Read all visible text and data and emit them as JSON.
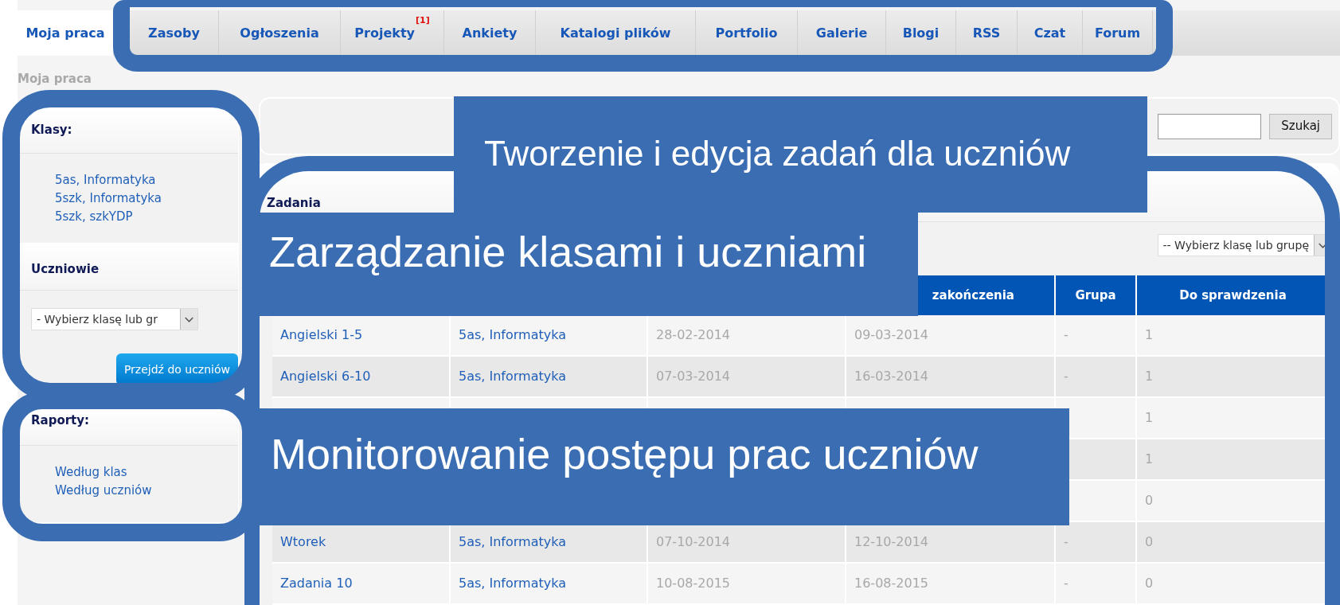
{
  "tabs": [
    {
      "label": "Moja praca",
      "selected": true
    },
    {
      "label": "Zasoby",
      "selected": false
    },
    {
      "label": "Ogłoszenia",
      "selected": false
    },
    {
      "label": "Projekty",
      "selected": false,
      "badge": "[1]"
    },
    {
      "label": "Ankiety",
      "selected": false
    },
    {
      "label": "Katalogi plików",
      "selected": false
    },
    {
      "label": "Portfolio",
      "selected": false
    },
    {
      "label": "Galerie",
      "selected": false
    },
    {
      "label": "Blogi",
      "selected": false
    },
    {
      "label": "RSS",
      "selected": false
    },
    {
      "label": "Czat",
      "selected": false
    },
    {
      "label": "Forum",
      "selected": false
    }
  ],
  "breadcrumb": "Moja praca",
  "sidebar": {
    "classes": {
      "title": "Klasy:",
      "links": [
        "5as, Informatyka",
        "5szk, Informatyka",
        "5szk, szkYDP"
      ]
    },
    "students": {
      "title": "Uczniowie",
      "select": "- Wybierz klasę lub gr",
      "button": "Przejdź do uczniów"
    },
    "reports": {
      "title": "Raporty:",
      "links": [
        "Według klas",
        "Według uczniów"
      ]
    }
  },
  "search": {
    "button": "Szukaj"
  },
  "tasks": {
    "title": "Zadania",
    "filter": "-- Wybierz klasę lub grupę",
    "columns": [
      {
        "label": "zakończenia"
      },
      {
        "label": "Grupa"
      },
      {
        "label": "Do sprawdzenia"
      }
    ],
    "rows": [
      {
        "name": "Angielski 1-5",
        "class": "5as, Informatyka",
        "start": "28-02-2014",
        "end": "09-03-2014",
        "group": "-",
        "check": "1"
      },
      {
        "name": "Angielski 6-10",
        "class": "5as, Informatyka",
        "start": "07-03-2014",
        "end": "16-03-2014",
        "group": "-",
        "check": "1"
      },
      {
        "check": "1"
      },
      {
        "check": "1"
      },
      {
        "check": "0"
      },
      {
        "name": "Wtorek",
        "class": "5as, Informatyka",
        "start": "07-10-2014",
        "end": "12-10-2014",
        "group": "-",
        "check": "0"
      },
      {
        "name": "Zadania 10",
        "class": "5as, Informatyka",
        "start": "10-08-2015",
        "end": "16-08-2015",
        "group": "-",
        "check": "0"
      }
    ]
  },
  "callouts": [
    {
      "text": "Tworzenie i edycja zadań dla uczniów"
    },
    {
      "text": "Zarządzanie klasami i uczniami"
    },
    {
      "text": "Monitorowanie postępu prac uczniów"
    }
  ]
}
